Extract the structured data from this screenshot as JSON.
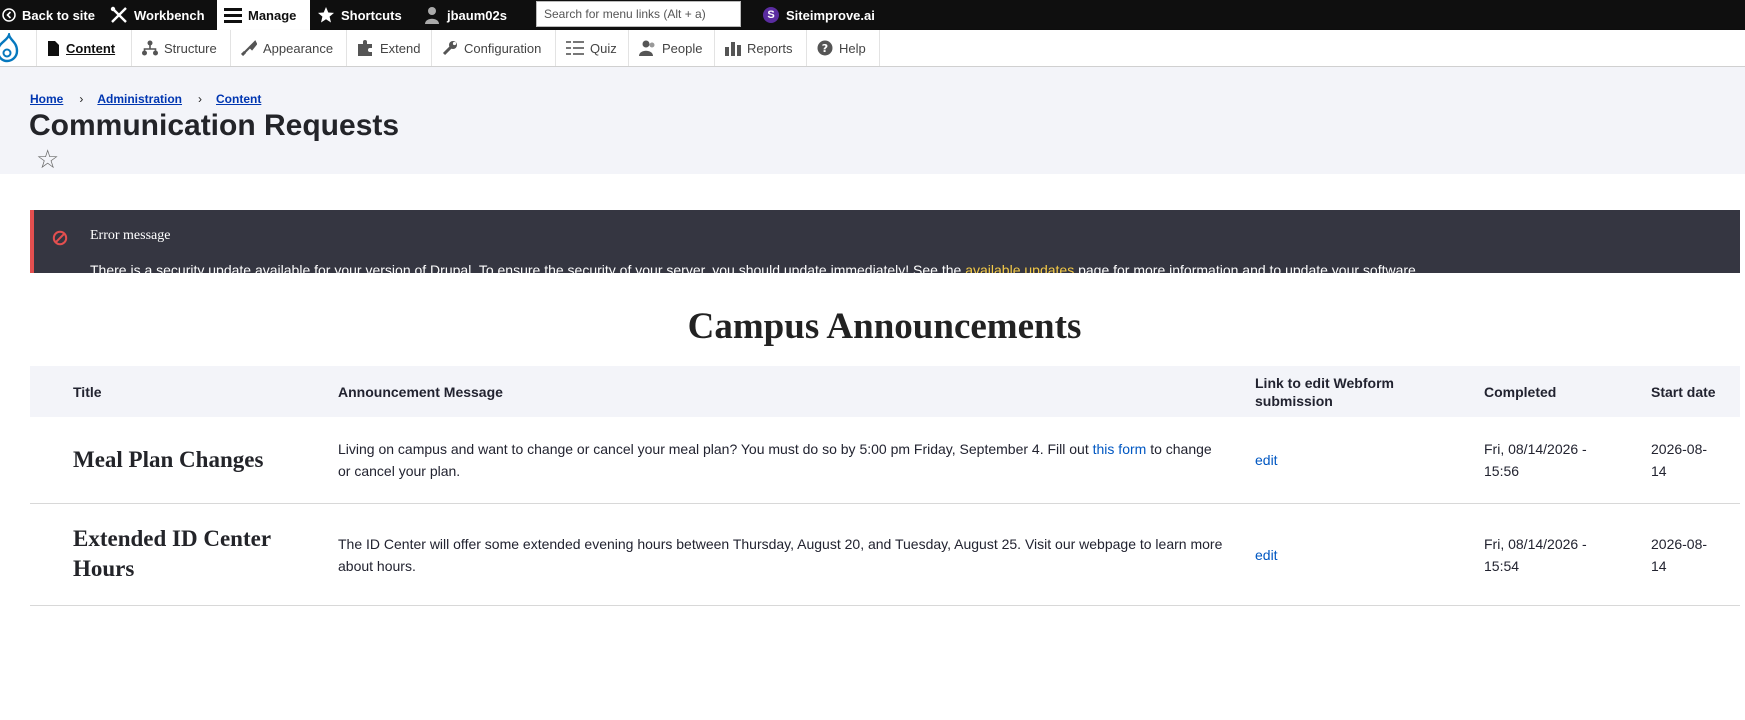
{
  "toolbar": {
    "back_label": "Back to site",
    "workbench_label": "Workbench",
    "manage_label": "Manage",
    "shortcuts_label": "Shortcuts",
    "user_label": "jbaum02s",
    "search_placeholder": "Search for menu links (Alt + a)",
    "siteimprove_label": "Siteimprove.ai",
    "siteimprove_badge": "S"
  },
  "tray": {
    "items": [
      {
        "label": "Content",
        "icon": "file-icon",
        "active": true
      },
      {
        "label": "Structure",
        "icon": "structure-icon"
      },
      {
        "label": "Appearance",
        "icon": "brush-icon"
      },
      {
        "label": "Extend",
        "icon": "puzzle-icon"
      },
      {
        "label": "Configuration",
        "icon": "wrench-icon"
      },
      {
        "label": "Quiz",
        "icon": "quiz-icon"
      },
      {
        "label": "People",
        "icon": "people-icon"
      },
      {
        "label": "Reports",
        "icon": "chart-icon"
      },
      {
        "label": "Help",
        "icon": "help-icon"
      }
    ]
  },
  "breadcrumb": {
    "items": [
      "Home",
      "Administration",
      "Content"
    ],
    "separator": "›"
  },
  "page": {
    "title": "Communication Requests",
    "star": "☆"
  },
  "error": {
    "title": "Error message",
    "text_before": "There is a security update available for your version of Drupal. To ensure the security of your server, you should update immediately! See the ",
    "link_text": "available updates",
    "text_after": " page for more information and to update your software."
  },
  "announcements": {
    "heading": "Campus Announcements",
    "columns": {
      "title": "Title",
      "message": "Announcement Message",
      "edit": "Link to edit Webform submission",
      "completed": "Completed",
      "start": "Start date"
    },
    "rows": [
      {
        "title": "Meal Plan Changes",
        "message_before": "Living on campus and want to change or cancel your meal plan? You must do so by 5:00 pm Friday, September 4. Fill out ",
        "message_link": "this form",
        "message_after": " to change or cancel your plan.",
        "edit_label": "edit",
        "completed": "Fri, 08/14/2026 - 15:56",
        "start_date": "2026-08-14"
      },
      {
        "title": "Extended ID Center Hours",
        "message_before": "The ID Center will offer some extended evening hours between Thursday, August 20, and Tuesday, August 25. Visit our webpage to learn more about hours.",
        "edit_label": "edit",
        "completed": "Fri, 08/14/2026 - 15:54",
        "start_date": "2026-08-14"
      }
    ]
  },
  "colors": {
    "toolbar_bg": "#0f0f0f",
    "header_bg": "#f3f4f9",
    "error_bg": "#353641",
    "error_accent": "#e34f4f",
    "link": "#0057c2",
    "warning_link": "#f5cb48"
  }
}
